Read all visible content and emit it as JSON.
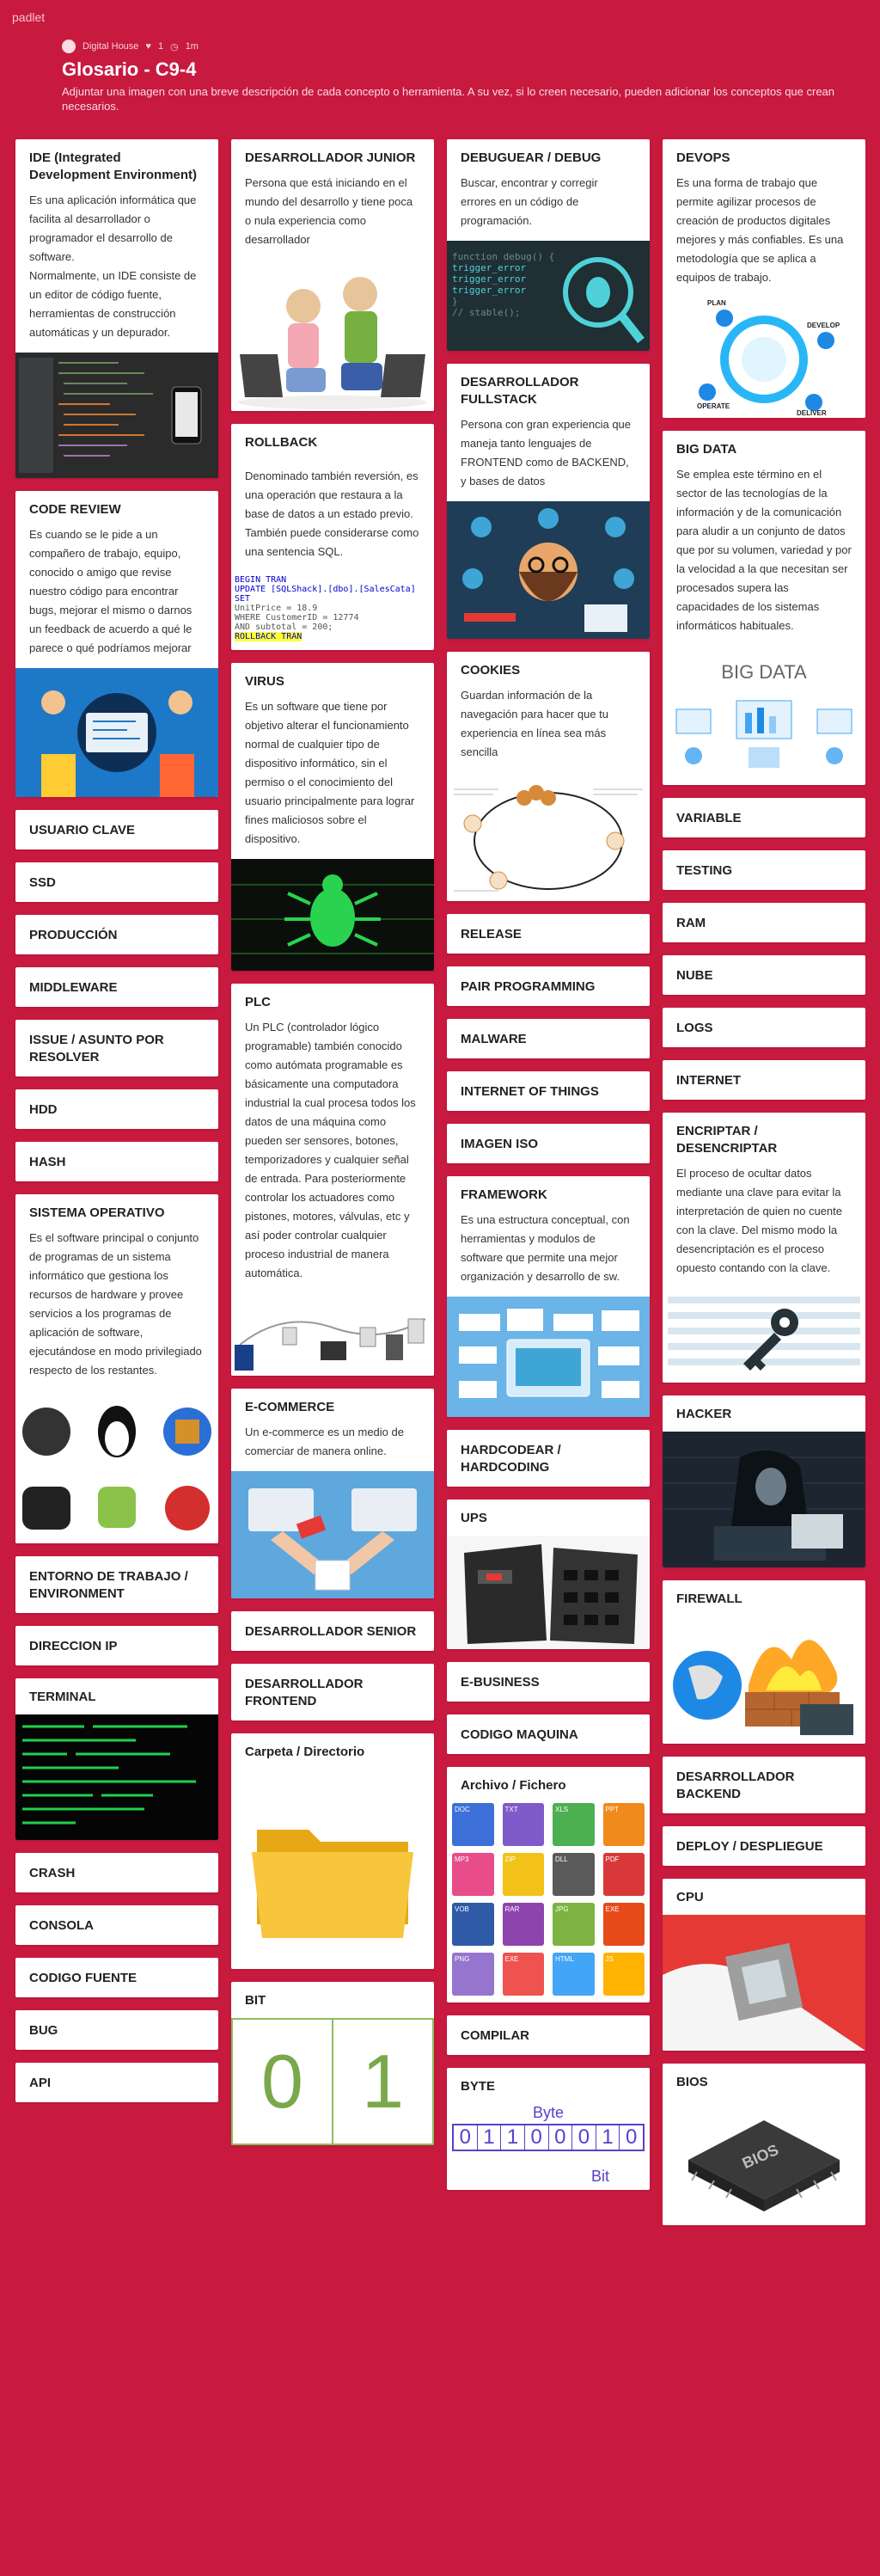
{
  "app": {
    "logo": "padlet"
  },
  "header": {
    "author": "Digital House",
    "likes": "1",
    "time": "1m",
    "title": "Glosario - C9-4",
    "subtitle": "Adjuntar una imagen con una breve descripción de cada concepto o herramienta. A su vez, si lo creen necesario, pueden adicionar los conceptos que crean necesarios."
  },
  "col1": {
    "c1": {
      "title": "IDE (Integrated Development Environment)",
      "body": "Es una aplicación informática que facilita al desarrollador o programador el desarrollo de software.\nNormalmente, un IDE consiste de un editor de código fuente, herramientas de construcción automáticas y un depurador."
    },
    "c2": {
      "title": "CODE REVIEW",
      "body": "Es cuando se le pide a un compañero de trabajo, equipo, conocido o amigo que revise nuestro código para encontrar bugs, mejorar el mismo o darnos un feedback de acuerdo a qué le parece o qué podríamos mejorar"
    },
    "c3": "USUARIO CLAVE",
    "c4": "SSD",
    "c5": "PRODUCCIÓN",
    "c6": "MIDDLEWARE",
    "c7": "ISSUE / ASUNTO POR RESOLVER",
    "c8": "HDD",
    "c9": "HASH",
    "c10": {
      "title": "SISTEMA OPERATIVO",
      "body": "Es el software principal o conjunto de programas de un sistema informático que gestiona los recursos de hardware y provee servicios a los programas de aplicación de software, ejecutándose en modo privilegiado respecto de los restantes."
    },
    "c11": "ENTORNO DE TRABAJO / ENVIRONMENT",
    "c12": "DIRECCION IP",
    "c13": "TERMINAL",
    "c14": "CRASH",
    "c15": "CONSOLA",
    "c16": "CODIGO FUENTE",
    "c17": "BUG",
    "c18": "API"
  },
  "col2": {
    "c1": {
      "title": "DESARROLLADOR JUNIOR",
      "body": "Persona que está iniciando en el mundo del desarrollo y tiene poca o nula experiencia como desarrollador"
    },
    "c2": {
      "title": "ROLLBACK",
      "body": "Denominado también reversión, es una operación que restaura a la base de datos a un estado previo. También puede considerarse como una sentencia SQL."
    },
    "sql": [
      "BEGIN TRAN",
      "UPDATE [SQLShack].[dbo].[SalesCata]",
      "  SET",
      "      UnitPrice = 18.9",
      "WHERE CustomerID = 12774",
      "      AND subtotal = 200;",
      "ROLLBACK TRAN"
    ],
    "c3": {
      "title": "VIRUS",
      "body": "Es un software que tiene por objetivo alterar el funcionamiento normal de cualquier tipo de dispositivo informático, sin el permiso o el conocimiento del usuario principalmente para lograr fines maliciosos sobre el dispositivo."
    },
    "c4": {
      "title": "PLC",
      "body": "Un PLC (controlador lógico programable) también conocido como autómata programable es básicamente una computadora industrial la cual procesa todos los datos de una máquina como pueden ser sensores, botones, temporizadores y cualquier señal de entrada. Para posteriormente controlar los actuadores como pistones, motores, válvulas, etc y así poder controlar cualquier proceso industrial de manera automática."
    },
    "c5": {
      "title": "E-COMMERCE",
      "body": "Un e-commerce es un medio de comerciar de manera online."
    },
    "c6": "DESARROLLADOR SENIOR",
    "c7": "DESARROLLADOR FRONTEND",
    "c8": "Carpeta / Directorio",
    "c9": "BIT",
    "bits": [
      "0",
      "1"
    ]
  },
  "col3": {
    "c1": {
      "title": "DEBUGUEAR / DEBUG",
      "body": "Buscar, encontrar y corregir errores en un código de programación."
    },
    "code": [
      "function debug() {",
      "  trigger_error",
      "  trigger_error",
      "  trigger_error",
      "}",
      "// stable();"
    ],
    "c2": {
      "title": "DESARROLLADOR FULLSTACK",
      "body": "Persona con gran experiencia que maneja tanto lenguajes de FRONTEND como de BACKEND, y bases de datos"
    },
    "c3": {
      "title": "COOKIES",
      "body": "Guardan información de la navegación para hacer que tu experiencia en línea sea más sencilla"
    },
    "c4": "RELEASE",
    "c5": "PAIR PROGRAMMING",
    "c6": "MALWARE",
    "c7": "INTERNET OF THINGS",
    "c8": "IMAGEN ISO",
    "c9": {
      "title": "FRAMEWORK",
      "body": "Es una estructura conceptual, con herramientas y modulos de software que permite una mejor organización y desarrollo de sw."
    },
    "c10": "HARDCODEAR / HARDCODING",
    "c11": "UPS",
    "c12": "E-BUSINESS",
    "c13": "CODIGO MAQUINA",
    "c14": "Archivo / Fichero",
    "files": [
      "DOC",
      "TXT",
      "XLS",
      "PPT",
      "MP3",
      "ZIP",
      "DLL",
      "PDF",
      "VOB",
      "RAR",
      "JPG",
      "EXE",
      "PNG",
      "EXE",
      "HTML",
      "JS"
    ],
    "c15": "COMPILAR",
    "c16": "BYTE",
    "byte": {
      "label": "Byte",
      "digits": [
        "0",
        "1",
        "1",
        "0",
        "0",
        "0",
        "1",
        "0"
      ],
      "bit_label": "Bit"
    }
  },
  "col4": {
    "c1": {
      "title": "DEVOPS",
      "body": "Es una forma de trabajo que permite agilizar procesos de creación de productos digitales mejores y más confiables. Es una metodología que se aplica a equipos de trabajo."
    },
    "devops": [
      "PLAN",
      "DEVELOP",
      "OPERATE",
      "DELIVER"
    ],
    "c2": {
      "title": "BIG DATA",
      "body": "Se emplea este término en el sector de las tecnologías de la información y de la comunicación para aludir a un conjunto de datos que por su volumen, variedad y por la velocidad a la que necesitan ser procesados supera las capacidades de los sistemas informáticos habituales."
    },
    "bigdata_label": "BIG DATA",
    "c3": "VARIABLE",
    "c4": "TESTING",
    "c5": "RAM",
    "c6": "NUBE",
    "c7": "LOGS",
    "c8": "INTERNET",
    "c9": {
      "title": "ENCRIPTAR / DESENCRIPTAR",
      "body": "El proceso de ocultar datos mediante una clave para evitar la interpretación de quien no cuente con la clave. Del mismo modo la desencriptación es el proceso opuesto contando con la clave."
    },
    "c10": "HACKER",
    "c11": "FIREWALL",
    "c12": "DESARROLLADOR BACKEND",
    "c13": "DEPLOY / DESPLIEGUE",
    "c14": "CPU",
    "c15": "BIOS",
    "bios_label": "BIOS"
  },
  "colors": {
    "background": "#c8193f",
    "card": "#ffffff"
  }
}
